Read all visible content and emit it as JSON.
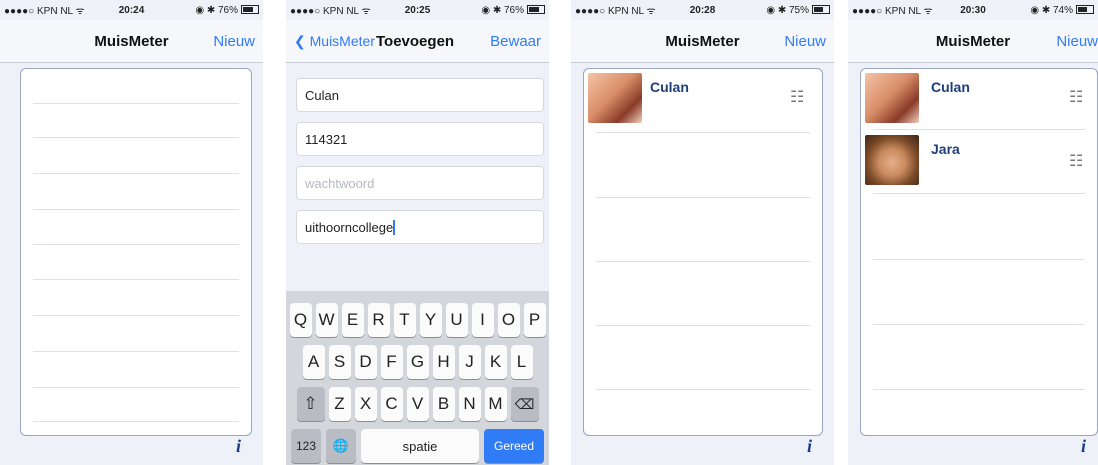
{
  "screens": [
    {
      "status": {
        "carrier": "●●●●○ KPN NL ᯤ",
        "time": "20:24",
        "right": "◉ ✱ 76%"
      },
      "nav": {
        "title": "MuisMeter",
        "right": "Nieuw"
      }
    },
    {
      "status": {
        "carrier": "●●●●○ KPN NL ᯤ",
        "time": "20:25",
        "right": "◉ ✱ 76%"
      },
      "nav": {
        "back": "MuisMeter",
        "title": "Toevoegen",
        "right": "Bewaar"
      },
      "fields": {
        "name": "Culan",
        "number": "114321",
        "password_placeholder": "wachtwoord",
        "school": "uithoorncollege"
      },
      "keyboard": {
        "row1": [
          "Q",
          "W",
          "E",
          "R",
          "T",
          "Y",
          "U",
          "I",
          "O",
          "P"
        ],
        "row2": [
          "A",
          "S",
          "D",
          "F",
          "G",
          "H",
          "J",
          "K",
          "L"
        ],
        "row3": [
          "Z",
          "X",
          "C",
          "V",
          "B",
          "N",
          "M"
        ],
        "shift": "⇧",
        "backspace": "⌫",
        "numbers": "123",
        "globe": "🌐",
        "space": "spatie",
        "done": "Gereed"
      }
    },
    {
      "status": {
        "carrier": "●●●●○ KPN NL ᯤ",
        "time": "20:28",
        "right": "◉ ✱ 75%"
      },
      "nav": {
        "title": "MuisMeter",
        "right": "Nieuw"
      },
      "people": [
        {
          "name": "Culan"
        }
      ]
    },
    {
      "status": {
        "carrier": "●●●●○ KPN NL ᯤ",
        "time": "20:30",
        "right": "◉ ✱ 74%"
      },
      "nav": {
        "title": "MuisMeter",
        "right": "Nieuw"
      },
      "people": [
        {
          "name": "Culan"
        },
        {
          "name": "Jara"
        }
      ]
    }
  ],
  "icons": {
    "info": "i",
    "list": "☷"
  }
}
